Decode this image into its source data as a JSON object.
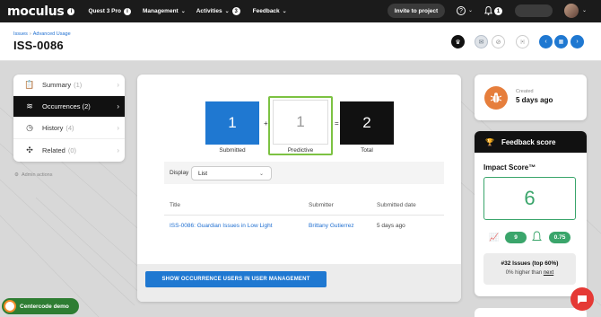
{
  "topnav": {
    "logo": "moculus",
    "items": [
      {
        "label": "Quest 3 Pro"
      },
      {
        "label": "Management"
      },
      {
        "label": "Activities",
        "badge": "3"
      },
      {
        "label": "Feedback"
      }
    ],
    "invite_label": "Invite to project",
    "notif_count": "1",
    "help": "?"
  },
  "header": {
    "breadcrumb": [
      "Issues",
      "Advanced Usage"
    ],
    "title": "ISS-0086"
  },
  "leftnav": {
    "items": [
      {
        "label": "Summary",
        "count": "(1)"
      },
      {
        "label": "Occurrences (2)",
        "count": ""
      },
      {
        "label": "History",
        "count": "(4)"
      },
      {
        "label": "Related",
        "count": "(0)"
      }
    ],
    "admin": "Admin actions"
  },
  "occurrences": {
    "submitted": {
      "value": "1",
      "label": "Submitted"
    },
    "predictive": {
      "value": "1",
      "label": "Predictive"
    },
    "total": {
      "value": "2",
      "label": "Total"
    },
    "plus": "+",
    "equals": "=",
    "display_label": "Display",
    "display_value": "List",
    "columns": [
      "Title",
      "Submitter",
      "Submitted date"
    ],
    "rows": [
      {
        "title": "ISS-0086: Guardian Issues in Low Light",
        "submitter": "Brittany Gutierrez",
        "date": "5 days ago"
      }
    ],
    "button": "SHOW OCCURRENCE USERS IN USER MANAGEMENT"
  },
  "created": {
    "label": "Created",
    "value": "5 days ago"
  },
  "feedback": {
    "title": "Feedback score",
    "impact_label": "Impact Score™",
    "score": "6",
    "metric1": "9",
    "metric2": "0.75",
    "rank": "#32 Issues (top 60%)",
    "rank_sub": "0% higher than",
    "rank_link": "next"
  },
  "demo": "Centercode demo",
  "colors": {
    "accent": "#1f78d1",
    "green": "#3aa56b",
    "orange": "#e67e3c",
    "dark": "#111111"
  }
}
